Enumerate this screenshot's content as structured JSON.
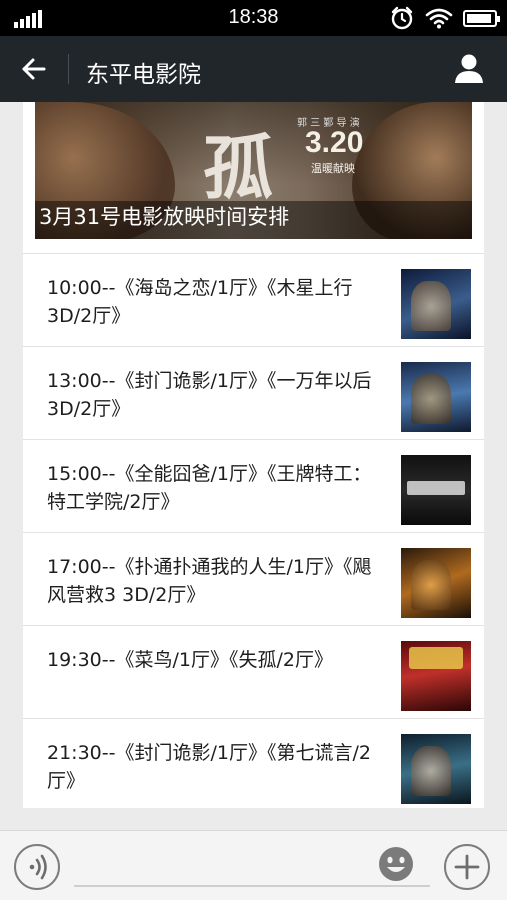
{
  "status_bar": {
    "time": "18:38",
    "icons": [
      "signal-icon",
      "alarm-icon",
      "wifi-icon",
      "battery-icon"
    ]
  },
  "nav": {
    "title": "东平电影院",
    "back_icon": "arrow-left-icon",
    "profile_icon": "person-icon"
  },
  "article": {
    "banner": {
      "poster_title": "孤",
      "poster_date": "3.20",
      "poster_small_top": "郭 三 鄞 导 演",
      "poster_small_bottom": "温暖献映",
      "caption": "3月31号电影放映时间安排"
    },
    "items": [
      {
        "text": "10:00--《海岛之恋/1厅》《木星上行3D/2厅》"
      },
      {
        "text": "13:00--《封门诡影/1厅》《一万年以后3D/2厅》"
      },
      {
        "text": "15:00--《全能囧爸/1厅》《王牌特工：特工学院/2厅》"
      },
      {
        "text": "17:00--《扑通扑通我的人生/1厅》《飓风营救3 3D/2厅》"
      },
      {
        "text": "19:30--《菜鸟/1厅》《失孤/2厅》"
      },
      {
        "text": "21:30--《封门诡影/1厅》《第七谎言/2厅》"
      }
    ]
  },
  "input_bar": {
    "text_value": "",
    "icons": [
      "voice-icon",
      "emoji-icon",
      "plus-icon"
    ]
  },
  "colors": {
    "nav_bg": "#21262b",
    "page_bg": "#ebebeb",
    "card_bg": "#ffffff"
  }
}
